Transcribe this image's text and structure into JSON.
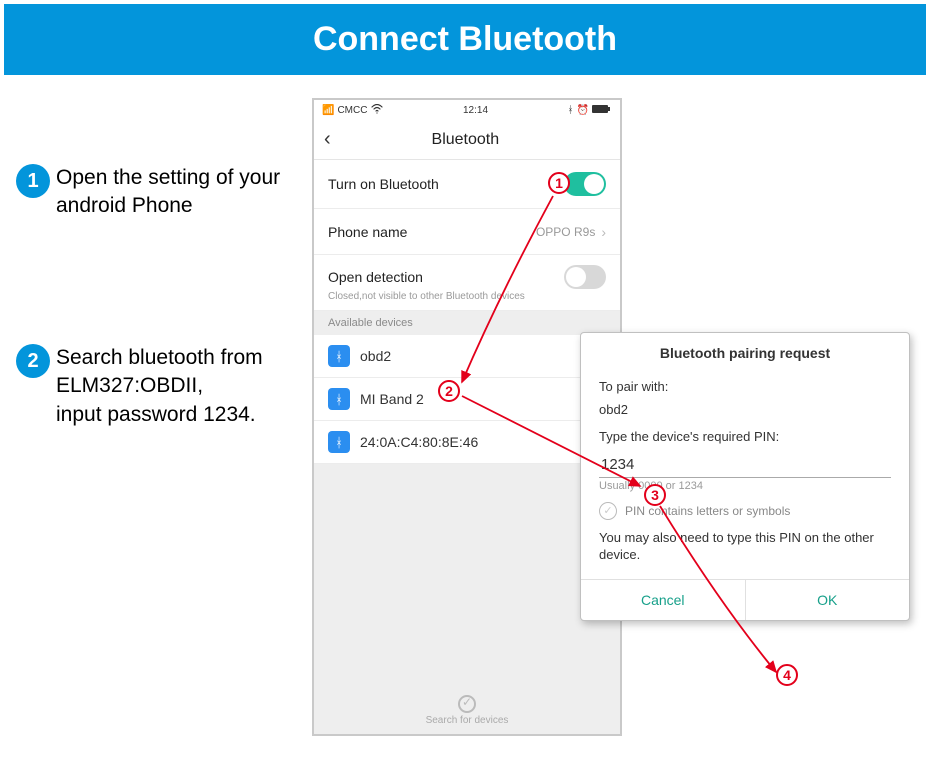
{
  "banner": {
    "title": "Connect Bluetooth"
  },
  "steps": [
    {
      "num": "1",
      "text": "Open the setting of your android Phone"
    },
    {
      "num": "2",
      "text": "Search bluetooth from ELM327:OBDII,\ninput password 1234."
    }
  ],
  "phone": {
    "status": {
      "carrier": "CMCC",
      "time": "12:14"
    },
    "header": {
      "back": "‹",
      "title": "Bluetooth"
    },
    "rows": {
      "turn_on": {
        "label": "Turn on Bluetooth"
      },
      "phone_name": {
        "label": "Phone name",
        "value": "OPPO R9s"
      },
      "open_detection": {
        "label": "Open detection",
        "sub": "Closed,not visible to other Bluetooth devices"
      }
    },
    "section": "Available devices",
    "devices": [
      {
        "name": "obd2"
      },
      {
        "name": "MI Band 2"
      },
      {
        "name": "24:0A:C4:80:8E:46"
      }
    ],
    "footer": "Search for devices"
  },
  "dialog": {
    "title": "Bluetooth pairing request",
    "pair_label": "To pair with:",
    "pair_device": "obd2",
    "pin_prompt": "Type the device's required PIN:",
    "pin_value": "1234",
    "pin_hint": "Usually 0000 or 1234",
    "checkbox": "PIN contains letters or symbols",
    "note": "You may also need to type this PIN on the other device.",
    "cancel": "Cancel",
    "ok": "OK"
  },
  "annotations": {
    "a1": "1",
    "a2": "2",
    "a3": "3",
    "a4": "4"
  }
}
